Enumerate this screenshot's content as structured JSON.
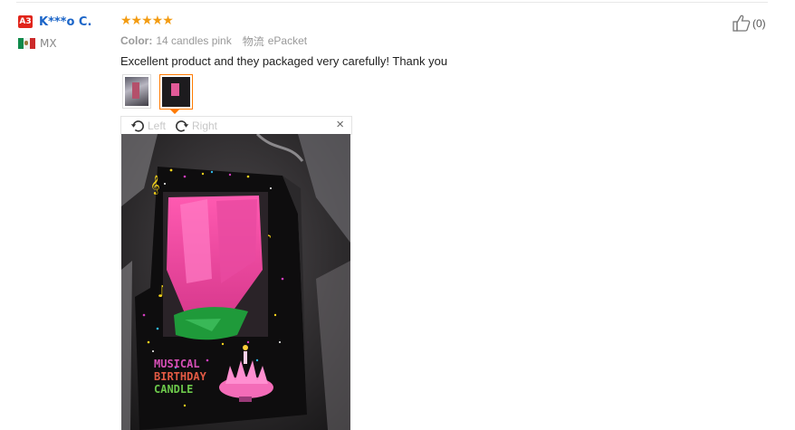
{
  "reviewer": {
    "level_badge": "A3",
    "name": "K***o C.",
    "country_code": "MX",
    "flag_icon": "mexico-flag-icon"
  },
  "review": {
    "rating": 5,
    "stars": "★★★★★",
    "color_label": "Color:",
    "color_value": "14 candles pink",
    "shipping_label": "物流",
    "shipping_value": "ePacket",
    "text": "Excellent product and they packaged very carefully! Thank you",
    "likes": "(0)"
  },
  "viewer": {
    "rotate_left_label": "Left",
    "rotate_right_label": "Right",
    "close_glyph": "×"
  },
  "photo": {
    "box_text": [
      "MUSICAL",
      "BIRTHDAY",
      "CANDLE"
    ]
  },
  "colors": {
    "brand_blue": "#1b65c8",
    "star_orange": "#f39c12",
    "active_thumb_border": "#ff7a00",
    "badge_red": "#e1251b"
  }
}
